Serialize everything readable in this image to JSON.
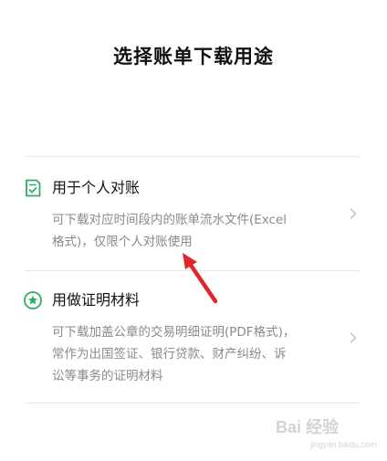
{
  "header": {
    "title": "选择账单下载用途"
  },
  "options": [
    {
      "icon": "checklist-document-icon",
      "title": "用于个人对账",
      "description_lines": [
        "可下载对应时间段内的账单流水文件(Excel",
        "格式)，仅限个人对账使用"
      ]
    },
    {
      "icon": "star-badge-icon",
      "title": "用做证明材料",
      "description_lines": [
        "可下载加盖公章的交易明细证明(PDF格式)，",
        "常作为出国签证、银行贷款、财产纠纷、诉",
        "讼等事务的证明材料"
      ]
    }
  ],
  "watermark": {
    "brand": "Bai 经验",
    "url": "jingyan.baidu.com"
  },
  "colors": {
    "accent": "#2aae67",
    "annotation_arrow": "#e0252b",
    "secondary_text": "#8a8a8a",
    "divider": "#e6e6e6"
  }
}
